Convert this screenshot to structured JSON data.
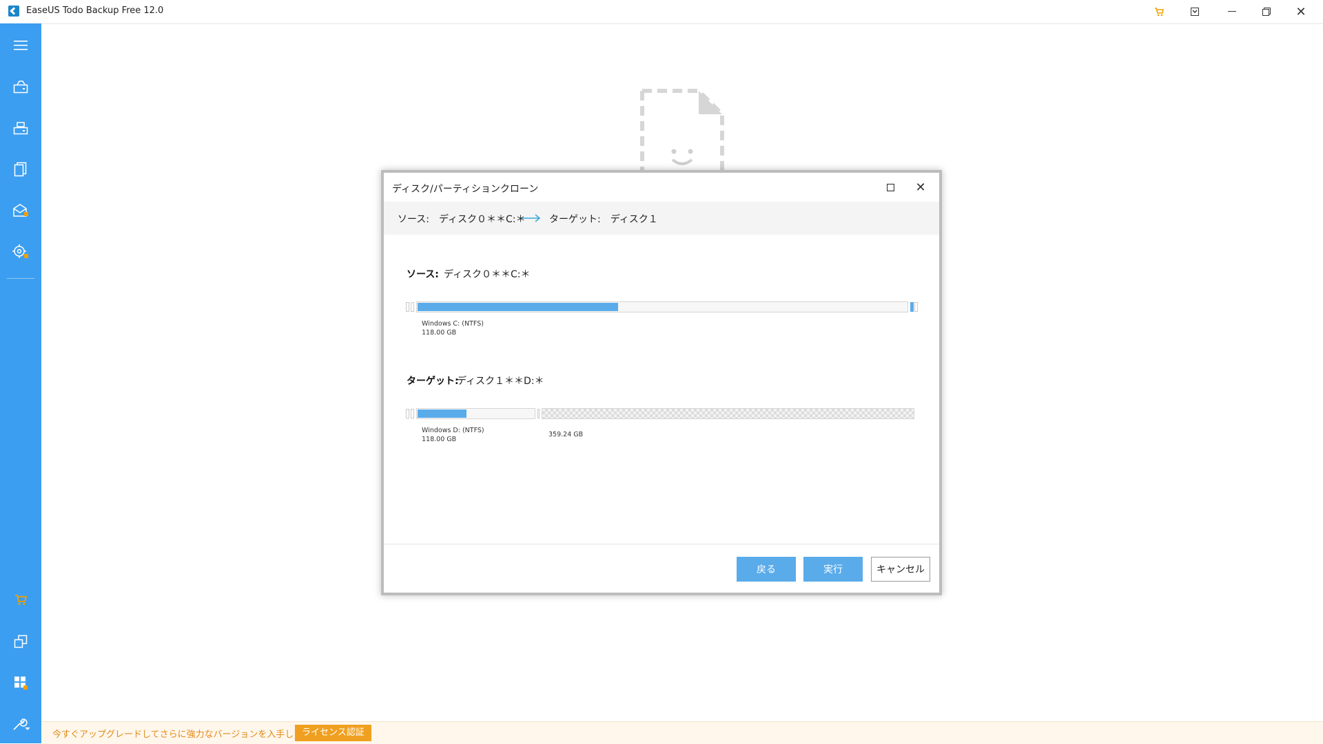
{
  "window": {
    "title": "EaseUS Todo Backup Free 12.0"
  },
  "titlebar_icons": [
    "cart-icon",
    "download-icon",
    "minimize-icon",
    "restore-icon",
    "close-icon"
  ],
  "sidebar": {
    "top_items": [
      {
        "name": "menu-icon"
      },
      {
        "name": "disk-backup-icon"
      },
      {
        "name": "system-backup-icon"
      },
      {
        "name": "file-backup-icon"
      },
      {
        "name": "mail-backup-icon"
      },
      {
        "name": "smart-backup-icon"
      }
    ],
    "bottom_items": [
      {
        "name": "cart-icon"
      },
      {
        "name": "clone-icon"
      },
      {
        "name": "windows-tools-icon"
      },
      {
        "name": "tools-icon"
      }
    ],
    "bg_color": "#3c9ef0"
  },
  "dialog": {
    "title": "ディスク/パーティションクローン",
    "path": {
      "source": "ソース:　ディスク０＊＊C:＊",
      "target": "ターゲット:　ディスク１"
    },
    "source_section": {
      "label": "ソース:",
      "value": "ディスク０＊＊C:＊",
      "partition": {
        "name": "Windows C: (NTFS)",
        "size": "118.00 GB",
        "used_fraction": 0.41
      }
    },
    "target_section": {
      "label": "ターゲット:",
      "value": "ディスク１＊＊D:＊",
      "partition": {
        "name": "Windows D: (NTFS)",
        "size": "118.00 GB",
        "used_fraction": 0.42
      },
      "unallocated": {
        "size": "359.24 GB"
      }
    },
    "buttons": {
      "back": "戻る",
      "execute": "実行",
      "cancel": "キャンセル"
    }
  },
  "upgrade_bar": {
    "text": "今すぐアップグレードしてさらに強力なバージョンを入手しましょう。",
    "license_button": "ライセンス認証"
  },
  "colors": {
    "accent": "#5aabea",
    "sidebar": "#3c9ef0",
    "upgrade_text": "#e38a16",
    "license_button": "#f0a020"
  }
}
